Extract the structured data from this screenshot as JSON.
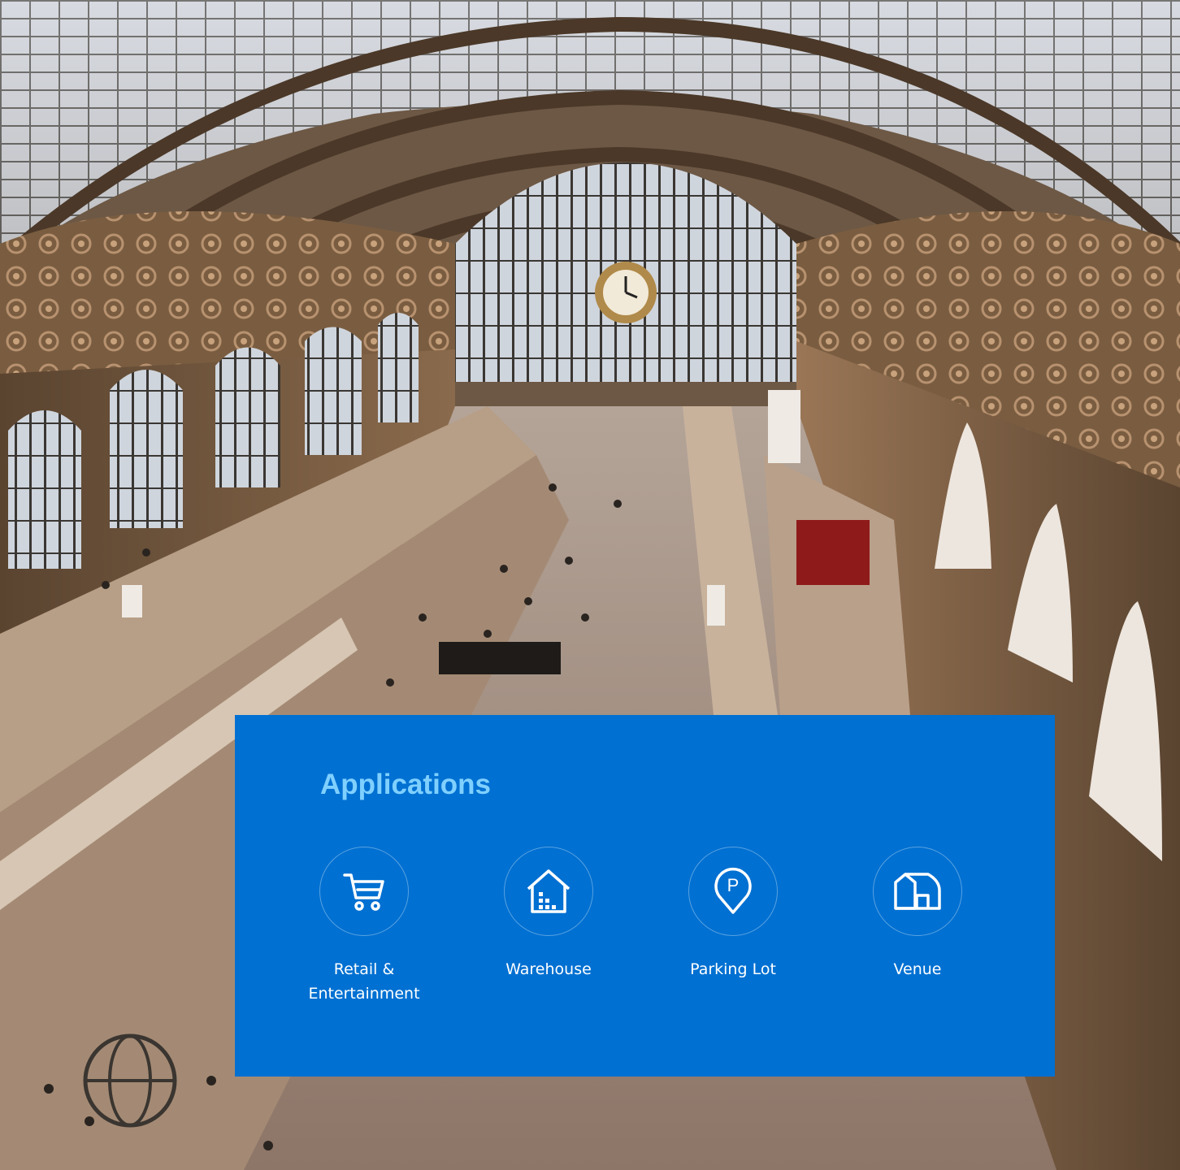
{
  "background": {
    "image": "museum-hall-photo",
    "description_icon": "arched-hall-photo"
  },
  "panel": {
    "title": "Applications",
    "bg_color": "#0070d2",
    "title_color": "#7fd0ff",
    "items": [
      {
        "label": "Retail &\nEntertainment",
        "icon": "shopping-cart-icon"
      },
      {
        "label": "Warehouse",
        "icon": "warehouse-icon"
      },
      {
        "label": "Parking Lot",
        "icon": "parking-pin-icon"
      },
      {
        "label": "Venue",
        "icon": "venue-building-icon"
      }
    ]
  }
}
